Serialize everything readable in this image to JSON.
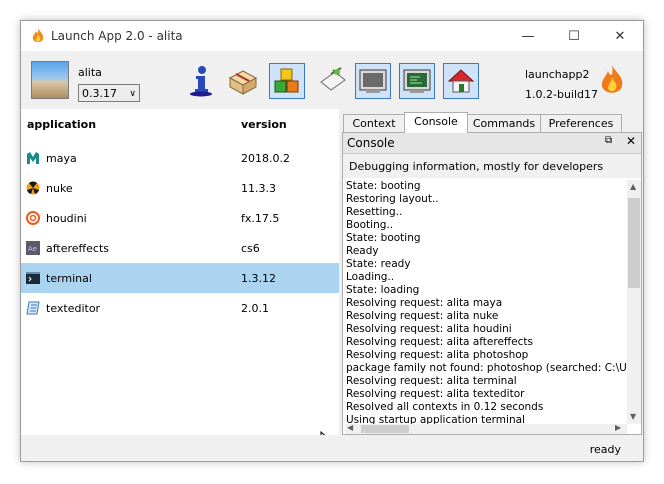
{
  "window": {
    "title": "Launch App 2.0 - alita"
  },
  "header": {
    "profile_name": "alita",
    "version_selected": "0.3.17",
    "app_name": "launchapp2",
    "build": "1.0.2-build17"
  },
  "toolbar": {
    "icons": [
      "info-icon",
      "package-icon",
      "cubes-icon",
      "stamp-icon",
      "terminal-window-icon",
      "console-window-icon",
      "home-icon"
    ]
  },
  "apps": {
    "col_application": "application",
    "col_version": "version",
    "rows": [
      {
        "name": "maya",
        "version": "2018.0.2",
        "icon": "maya-icon"
      },
      {
        "name": "nuke",
        "version": "11.3.3",
        "icon": "nuke-icon"
      },
      {
        "name": "houdini",
        "version": "fx.17.5",
        "icon": "houdini-icon"
      },
      {
        "name": "aftereffects",
        "version": "cs6",
        "icon": "aftereffects-icon"
      },
      {
        "name": "terminal",
        "version": "1.3.12",
        "icon": "terminal-icon",
        "selected": true
      },
      {
        "name": "texteditor",
        "version": "2.0.1",
        "icon": "texteditor-icon"
      }
    ]
  },
  "tabs": [
    "Context",
    "Console",
    "Commands",
    "Preferences"
  ],
  "console": {
    "title": "Console",
    "description": "Debugging information, mostly for developers",
    "lines": [
      "State: booting",
      "Restoring layout..",
      "Resetting..",
      "Booting..",
      "State: booting",
      "Ready",
      "State: ready",
      "Loading..",
      "State: loading",
      "Resolving request: alita maya",
      "Resolving request: alita nuke",
      "Resolving request: alita houdini",
      "Resolving request: alita aftereffects",
      "Resolving request: alita photoshop",
      "package family not found: photoshop (searched: C:\\Users",
      "Resolving request: alita terminal",
      "Resolving request: alita texteditor",
      "Resolved all contexts in 0.12 seconds",
      "Using startup application terminal"
    ]
  },
  "status": {
    "text": "ready"
  },
  "colors": {
    "selection": "#aad4f0",
    "accent": "#3a78c2"
  }
}
